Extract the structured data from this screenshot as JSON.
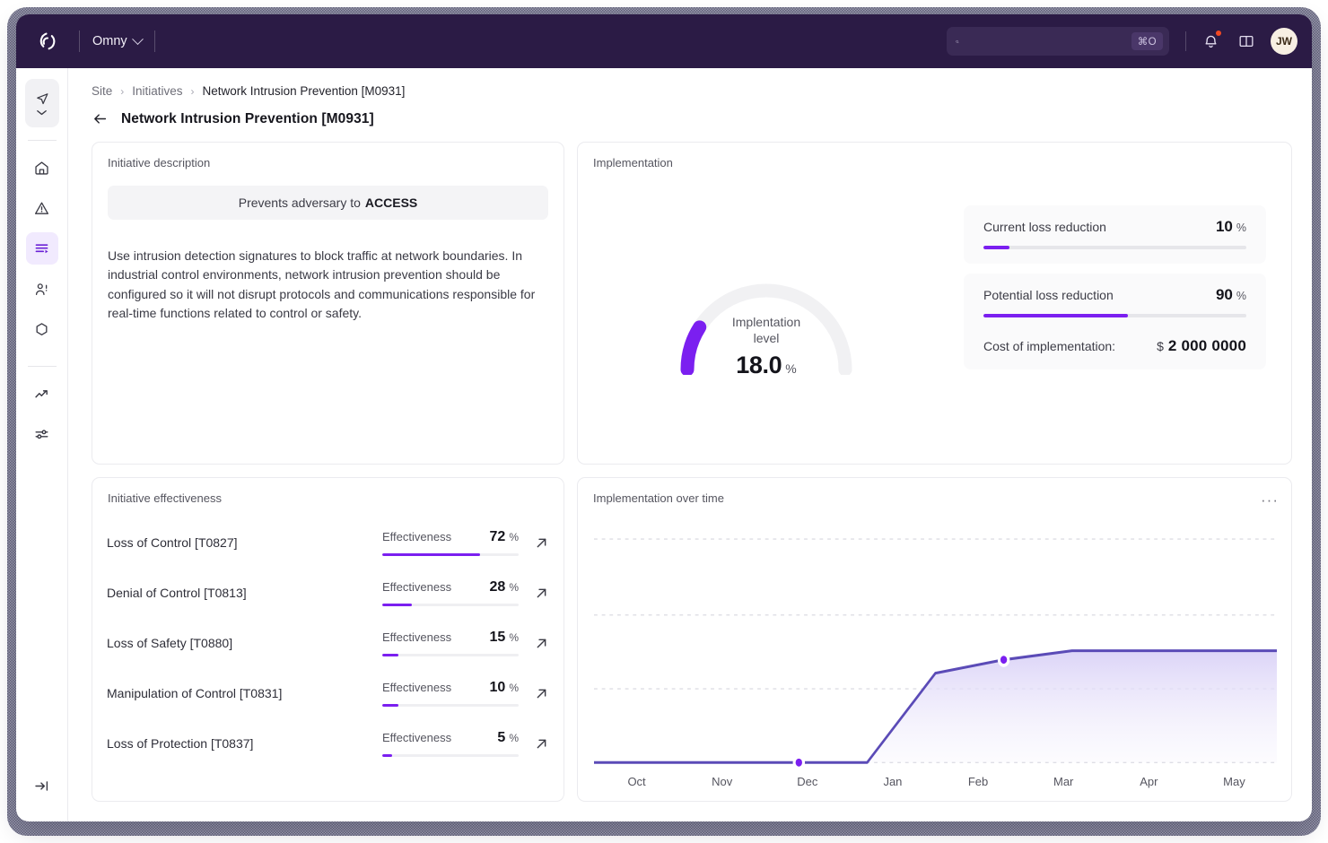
{
  "topbar": {
    "logo_name": "omny-logo",
    "org": "Omny",
    "search_placeholder": "",
    "search_value": "",
    "search_shortcut": "⌘O",
    "notification_icon": "bell-icon",
    "docs_icon": "book-icon",
    "avatar_initials": "JW"
  },
  "sidebar": {
    "items": [
      {
        "name": "nav-explore",
        "icon": "navigation-icon"
      },
      {
        "name": "sidebar-item-home",
        "icon": "home-icon",
        "active": false
      },
      {
        "name": "sidebar-item-alerts",
        "icon": "alert-triangle-icon",
        "active": false
      },
      {
        "name": "sidebar-item-initiatives",
        "icon": "list-play-icon",
        "active": true
      },
      {
        "name": "sidebar-item-people",
        "icon": "people-icon",
        "active": false
      },
      {
        "name": "sidebar-item-assets",
        "icon": "hexagon-icon",
        "active": false
      },
      {
        "name": "sidebar-item-trends",
        "icon": "trending-up-icon",
        "active": false
      },
      {
        "name": "sidebar-item-settings",
        "icon": "sliders-icon",
        "active": false
      },
      {
        "name": "sidebar-expand",
        "icon": "expand-panel-icon",
        "active": false
      }
    ]
  },
  "breadcrumb": {
    "site": "Site",
    "initiatives": "Initiatives",
    "current": "Network Intrusion Prevention [M0931]",
    "sep": "›"
  },
  "page": {
    "back_icon": "arrow-left-icon",
    "title": "Network Intrusion Prevention [M0931]"
  },
  "description_card": {
    "title": "Initiative description",
    "pill_prefix": "Prevents adversary to",
    "pill_strong": "ACCESS",
    "body": "Use intrusion detection signatures to block traffic at network boundaries. In industrial control environments, network intrusion prevention should be configured so it will not disrupt protocols and communications responsible for real-time functions related to control or safety."
  },
  "implementation_card": {
    "title": "Implementation",
    "gauge": {
      "label_line1": "Implentation",
      "label_line2": "level",
      "value": "18.0",
      "unit": "%",
      "percent": 18,
      "fill_color": "#7B1FF0",
      "track_color": "#F1F1F3"
    },
    "stats": [
      {
        "name": "Current loss reduction",
        "value": "10",
        "unit": "%",
        "percent": 10
      },
      {
        "name": "Potential loss reduction",
        "value": "90",
        "unit": "%",
        "percent": 55
      }
    ],
    "cost_label": "Cost of implementation:",
    "cost_currency": "$",
    "cost_amount": "2 000 0000"
  },
  "effectiveness_card": {
    "title": "Initiative effectiveness",
    "metric_label": "Effectiveness",
    "unit": "%",
    "link_icon": "arrow-up-right-icon",
    "rows": [
      {
        "name": "Loss of Control [T0827]",
        "value": "72",
        "percent": 72
      },
      {
        "name": "Denial of Control [T0813]",
        "value": "28",
        "percent": 22
      },
      {
        "name": "Loss of Safety [T0880]",
        "value": "15",
        "percent": 12
      },
      {
        "name": "Manipulation of Control [T0831]",
        "value": "10",
        "percent": 12
      },
      {
        "name": "Loss of Protection [T0837]",
        "value": "5",
        "percent": 7
      }
    ]
  },
  "time_card": {
    "title": "Implementation over time",
    "menu_icon": "ellipsis-icon",
    "menu_label": "···"
  },
  "chart_data": {
    "type": "area",
    "title": "Implementation over time",
    "xlabel": "",
    "ylabel": "",
    "grid": true,
    "legend": "none",
    "line_color": "#5B4BB7",
    "fill_color": "#EDE9FB",
    "marker_color": "#7B1FF0",
    "categories": [
      "Oct",
      "Nov",
      "Dec",
      "Jan",
      "Feb",
      "Mar",
      "Apr",
      "May"
    ],
    "ylim": [
      0,
      100
    ],
    "gridline_values": [
      100,
      66,
      33,
      0
    ],
    "x": [
      "Oct",
      "Nov",
      "Dec",
      "Dec-15",
      "Jan",
      "Jan-15",
      "Feb",
      "Feb-15",
      "Mar",
      "Apr",
      "May"
    ],
    "values": [
      0,
      0,
      0,
      0,
      0,
      40,
      46,
      50,
      50,
      50,
      50
    ],
    "markers": [
      {
        "x": "Dec-15",
        "value": 0
      },
      {
        "x": "Feb",
        "value": 46
      }
    ]
  },
  "colors": {
    "brand_purple": "#7B1FF0",
    "header_bg": "#2B1B45",
    "active_nav_bg": "#F1EAFE",
    "alert_dot": "#F24822"
  }
}
